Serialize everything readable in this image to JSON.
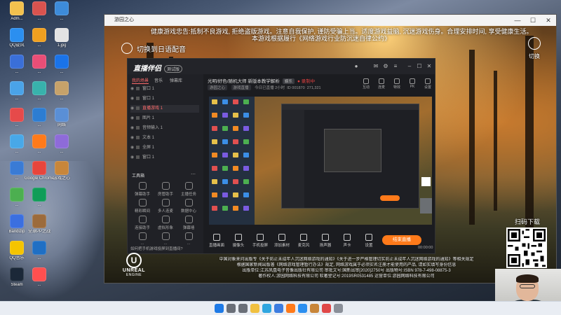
{
  "desktop": {
    "icons": [
      {
        "label": "Adm...",
        "icon": "folder-icon",
        "color": "#f2c14e"
      },
      {
        "label": "QQ旋风",
        "icon": "qq-icon",
        "color": "#2b8ff0"
      },
      {
        "label": "...",
        "icon": "app-icon",
        "color": "#3a6fd8"
      },
      {
        "label": "...",
        "icon": "computer-icon",
        "color": "#4aa3e8"
      },
      {
        "label": "...",
        "icon": "app-icon",
        "color": "#e64a4a"
      },
      {
        "label": "...",
        "icon": "app-icon",
        "color": "#48a8e8"
      },
      {
        "label": "...",
        "icon": "app-icon",
        "color": "#3a7bd5"
      },
      {
        "label": "...",
        "icon": "app-icon",
        "color": "#4caf50"
      },
      {
        "label": "Bandizip",
        "icon": "bandizip-icon",
        "color": "#3b6fe0"
      },
      {
        "label": "QQ音乐",
        "icon": "qq-music-icon",
        "color": "#f5c400"
      },
      {
        "label": "Steam",
        "icon": "steam-icon",
        "color": "#1b2838"
      },
      {
        "label": "...",
        "icon": "app-icon",
        "color": "#d9534f"
      },
      {
        "label": "...",
        "icon": "app-icon",
        "color": "#f0a020"
      },
      {
        "label": "...",
        "icon": "app-icon",
        "color": "#e94e77"
      },
      {
        "label": "...",
        "icon": "app-icon",
        "color": "#38b2ac"
      },
      {
        "label": "...",
        "icon": "app-icon",
        "color": "#2d7dd2"
      },
      {
        "label": "...",
        "icon": "app-icon",
        "color": "#ff7a1a"
      },
      {
        "label": "Google Chrome",
        "icon": "chrome-icon",
        "color": "#e8453c"
      },
      {
        "label": "...",
        "icon": "app-icon",
        "color": "#0f9d58"
      },
      {
        "label": "全球PP之战",
        "icon": "game-icon",
        "color": "#9c6b3c"
      },
      {
        "label": "...",
        "icon": "app-icon",
        "color": "#1f6fc4"
      },
      {
        "label": "...",
        "icon": "app-icon",
        "color": "#ff4f4f"
      },
      {
        "label": "...",
        "icon": "app-icon",
        "color": "#3d8bd9"
      },
      {
        "label": "1.jpg",
        "icon": "image-icon",
        "color": "#e3e3e3"
      },
      {
        "label": "...",
        "icon": "app-icon",
        "color": "#1a73e8"
      },
      {
        "label": "...",
        "icon": "app-icon",
        "color": "#c6a26a"
      },
      {
        "label": "网络",
        "icon": "network-icon",
        "color": "#5a8fd6"
      },
      {
        "label": "...",
        "icon": "app-icon",
        "color": "#8e6bd9"
      },
      {
        "label": "游戏之心",
        "icon": "game-icon",
        "color": "#c8863a"
      }
    ]
  },
  "window": {
    "title": "游园之心",
    "minimize": "—",
    "maximize": "☐",
    "close": "✕"
  },
  "game": {
    "notice_line1": "健康游戏忠告:抵制不良游戏, 拒绝盗版游戏。注意自我保护, 谨防受骗上当。适度游戏益脑, 沉迷游戏伤身。合理安排时间, 享受健康生活。",
    "notice_line2": "本游戏根据履行《网络游戏行业防沉迷自律公约》",
    "switch_dub": "切换到日语配音",
    "switch_right": "切换",
    "unreal": "UNREAL",
    "unreal_sub": "ENGINE",
    "footer_lines": [
      "中国对象来问出版专《关于防止未成年人沉迷网络游戏的通知》《关于进一步严格管理切实防止未成年人沉迷网络游戏的通知》等相关规定",
      "根据国家新闻出版署《网络游戏管理暂行办法》规定, 网络游戏属于必须实名注册才能使用的产品, 请如实填写身份信息",
      "出版单位:江苏凤凰电子音像出版社有限公司 审批文号:国新出审[2020]2750号 出版物号:ISBN 978-7-498-08875-3",
      "著作权人:游园网络科技有限公司 软著登记号:2019SR0531485 运营单位:游园网络科技有限公司"
    ],
    "scan_download": "扫码下载"
  },
  "stream_app": {
    "logo": "直播伴侣",
    "version": "测试版",
    "tabs": [
      "我的场景",
      "音乐",
      "弹幕库"
    ],
    "scenes": [
      {
        "label": "窗口 1",
        "selected": false
      },
      {
        "label": "窗口 1",
        "selected": false
      },
      {
        "label": "直播游戏 1",
        "selected": true
      },
      {
        "label": "图片 1",
        "selected": false
      },
      {
        "label": "音频输入 1",
        "selected": false
      },
      {
        "label": "文本 1",
        "selected": false
      },
      {
        "label": "全屏 1",
        "selected": false
      },
      {
        "label": "窗口 1",
        "selected": false
      }
    ],
    "tools_title": "工具箱",
    "tools": [
      {
        "label": "弹幕助手",
        "icon": "danmaku-icon"
      },
      {
        "label": "房管助手",
        "icon": "admin-icon"
      },
      {
        "label": "主播任务",
        "icon": "task-icon"
      },
      {
        "label": "精彩瞬间",
        "icon": "highlight-icon"
      },
      {
        "label": "多人连麦",
        "icon": "multi-mic-icon"
      },
      {
        "label": "数据中心",
        "icon": "data-icon"
      },
      {
        "label": "连接助手",
        "icon": "link-icon"
      },
      {
        "label": "虚拟形象",
        "icon": "avatar-icon"
      },
      {
        "label": "弹幕墙",
        "icon": "wall-icon"
      },
      {
        "label": "...",
        "icon": "more-icon"
      },
      {
        "label": "...",
        "icon": "more-icon"
      },
      {
        "label": "...",
        "icon": "more-icon"
      }
    ],
    "title": "光明/好色/随机大师 新版本教学解析",
    "title_badge": "娱乐",
    "rec": "● 录制中",
    "sub_tags": [
      "游园之心",
      "游戏直播"
    ],
    "sub_info": "今日已直播 2小时",
    "room_id": "ID 001870",
    "viewers": "271,321",
    "actions": [
      "互动",
      "连麦",
      "特效",
      "PK",
      "设置"
    ],
    "bottom_buttons": [
      {
        "label": "直播画面",
        "icon": "screen-icon"
      },
      {
        "label": "摄像头",
        "icon": "camera-icon"
      },
      {
        "label": "手机投屏",
        "icon": "phone-cast-icon"
      },
      {
        "label": "添加素材",
        "icon": "add-source-icon"
      },
      {
        "label": "麦克风",
        "icon": "mic-icon"
      },
      {
        "label": "扬声器",
        "icon": "speaker-icon"
      },
      {
        "label": "声卡",
        "icon": "soundcard-icon"
      },
      {
        "label": "设置",
        "icon": "settings-icon"
      }
    ],
    "start_live": "结束直播",
    "ask_ai": "如何把手机游戏投屏到直播间?",
    "timer": "00:00:00"
  },
  "taskbar": {
    "icons": [
      {
        "name": "start-icon",
        "color": "#1e7ae6"
      },
      {
        "name": "search-icon",
        "color": "#6a6f78"
      },
      {
        "name": "task-view-icon",
        "color": "#6a6f78"
      },
      {
        "name": "explorer-icon",
        "color": "#f0c040"
      },
      {
        "name": "edge-icon",
        "color": "#2fa6e0"
      },
      {
        "name": "store-icon",
        "color": "#3d7de0"
      },
      {
        "name": "stream-app-icon",
        "color": "#ff7a1a"
      },
      {
        "name": "qq-icon",
        "color": "#2b8ff0"
      },
      {
        "name": "game-icon",
        "color": "#c8863a"
      },
      {
        "name": "app-icon",
        "color": "#e04848"
      },
      {
        "name": "app-icon",
        "color": "#8a8f98"
      }
    ]
  }
}
